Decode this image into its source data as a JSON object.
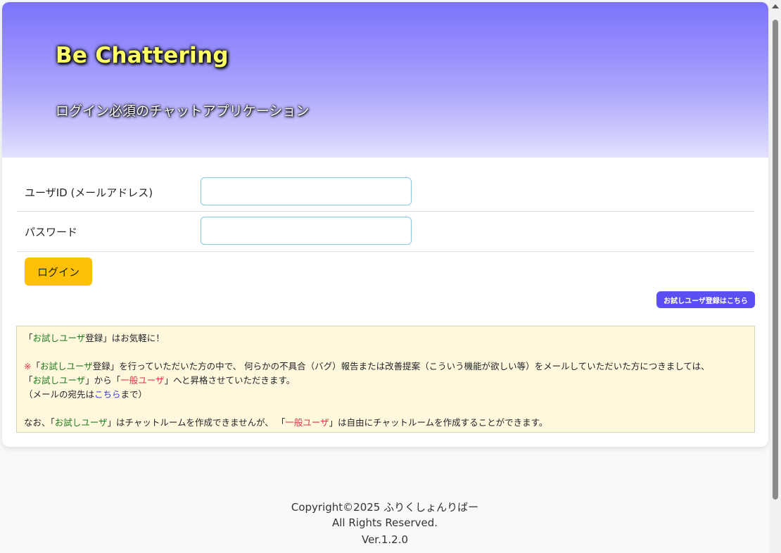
{
  "header": {
    "title": "Be Chattering",
    "subtitle": "ログイン必須のチャットアプリケーション"
  },
  "form": {
    "userid_label": "ユーザID (メールアドレス)",
    "userid_value": "",
    "password_label": "パスワード",
    "password_value": "",
    "login_label": "ログイン",
    "trial_register_label": "お試しユーザ登録はこちら"
  },
  "notice": {
    "line1_prefix": "「",
    "line1_green": "お試しユーザ",
    "line1_suffix": "登録」はお気軽に！",
    "mark": "※",
    "line2_a": "「",
    "line2_green": "お試しユーザ",
    "line2_b": "登録」を行っていただいた方の中で、 何らかの不具合（バグ）報告または改善提案（こういう機能が欲しい等）をメールしていただいた方につきましては、",
    "line3_a": "「",
    "line3_green": "お試しユーザ",
    "line3_b": "」から「",
    "line3_red": "一般ユーザ",
    "line3_c": "」へと昇格させていただきます。",
    "line4_a": "（メールの宛先は",
    "line4_link": "こちら",
    "line4_b": "まで）",
    "line5_a": "なお、「",
    "line5_green": "お試しユーザ",
    "line5_b": "」はチャットルームを作成できませんが、 「",
    "line5_red": "一般ユーザ",
    "line5_c": "」は自由にチャットルームを作成することができます。"
  },
  "footer": {
    "copyright": "Copyright©2025 ふりくしょんりばー",
    "rights": "All Rights Reserved.",
    "version": "Ver.1.2.0"
  },
  "colors": {
    "accent_button": "#ffc107",
    "trial_button": "#5b4ef2",
    "header_gradient_top": "#7c72fb",
    "notice_bg": "#fff8dc"
  }
}
